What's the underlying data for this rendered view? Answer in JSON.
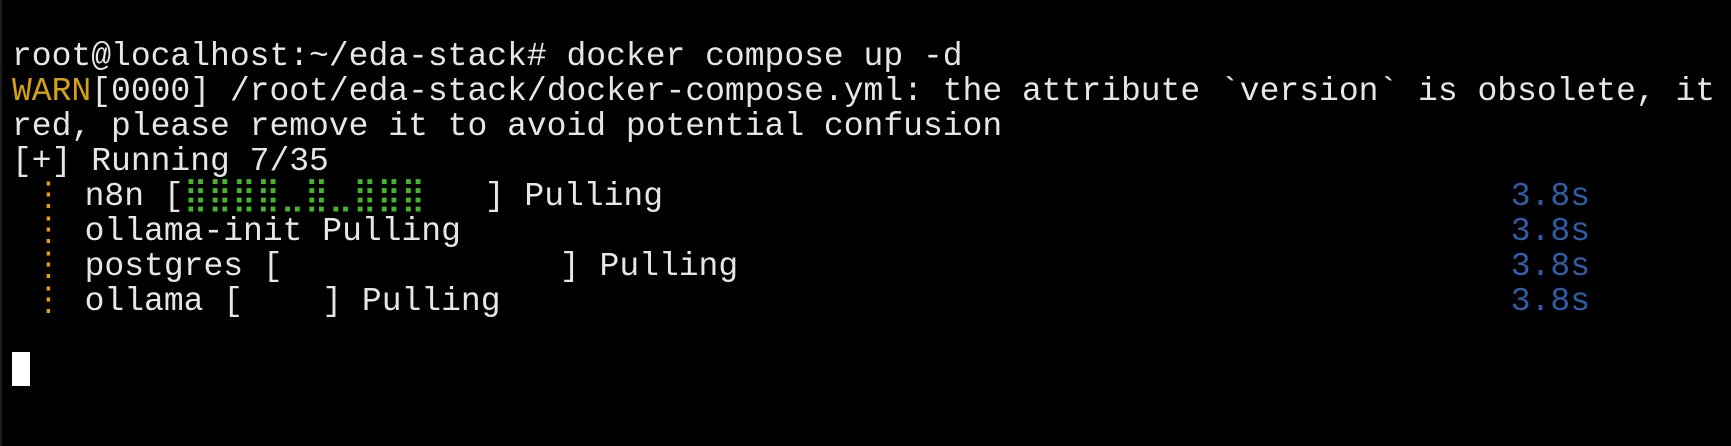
{
  "terminal": {
    "prompt": "root@localhost:~/eda-stack#",
    "command": " docker compose up -d",
    "warn_prefix": "WARN",
    "warn_line1_rest": "[0000] /root/eda-stack/docker-compose.yml: the attribute `version` is obsolete, it",
    "warn_line2": "red, please remove it to avoid potential confusion",
    "running_status": "[+] Running 7/35",
    "services": [
      {
        "spinner": "⋮",
        "name": "n8n",
        "bar_open": " [",
        "bar_fill": "⣿⣿⣿⣿⣀⣿⣀⣿⣿⣿",
        "bar_space": "   ",
        "bar_close": "]",
        "status": " Pulling",
        "time": "3.8s"
      },
      {
        "spinner": "⋮",
        "name": "ollama-init",
        "status": " Pulling",
        "time": "3.8s"
      },
      {
        "spinner": "⋮",
        "name": "postgres",
        "bar_open": " [",
        "bar_space": "              ",
        "bar_close": "]",
        "status": " Pulling",
        "time": "3.8s"
      },
      {
        "spinner": "⋮",
        "name": "ollama",
        "bar_open": " [",
        "bar_space": "    ",
        "bar_close": "]",
        "status": " Pulling",
        "time": "3.8s"
      }
    ]
  },
  "colors": {
    "background": "#000000",
    "text": "#e6e6e6",
    "warn": "#d4a017",
    "progress": "#44b62a",
    "spinner": "#f0a000",
    "time": "#2e5ea8"
  }
}
